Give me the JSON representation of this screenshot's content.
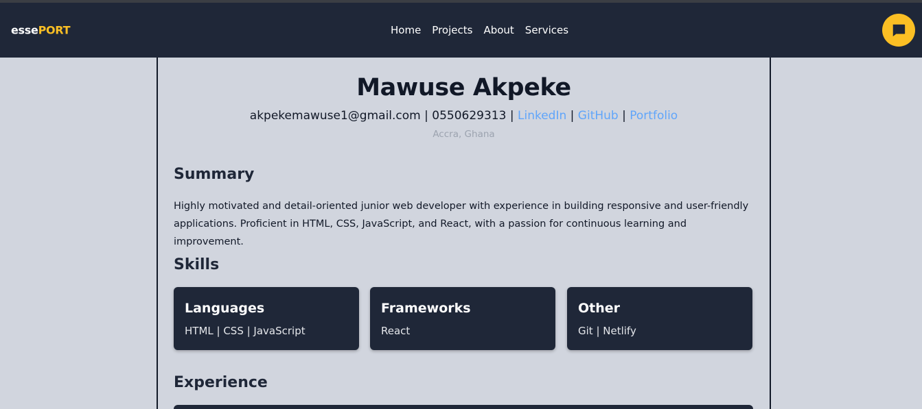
{
  "nav": {
    "brand_part1": "esse",
    "brand_part2": "PORT",
    "links": [
      "Home",
      "Projects",
      "About",
      "Services"
    ],
    "chat_icon": "chat-bubble-icon"
  },
  "header": {
    "name": "Mawuse Akpeke",
    "email": "akpekemawuse1@gmail.com",
    "phone": "0550629313",
    "separator": " | ",
    "links": [
      "LinkedIn",
      "GitHub",
      "Portfolio"
    ],
    "location": "Accra, Ghana"
  },
  "summary": {
    "title": "Summary",
    "text": "Highly motivated and detail-oriented junior web developer with experience in building responsive and user-friendly applications. Proficient in HTML, CSS, JavaScript, and React, with a passion for continuous learning and improvement."
  },
  "skills": {
    "title": "Skills",
    "cards": [
      {
        "title": "Languages",
        "items": "HTML | CSS | JavaScript"
      },
      {
        "title": "Frameworks",
        "items": "React"
      },
      {
        "title": "Other",
        "items": "Git | Netlify"
      }
    ]
  },
  "experience": {
    "title": "Experience"
  },
  "colors": {
    "navbar": "#1f2738",
    "accent": "#fbbf24",
    "link": "#60a5fa",
    "background": "#d1d5de"
  }
}
